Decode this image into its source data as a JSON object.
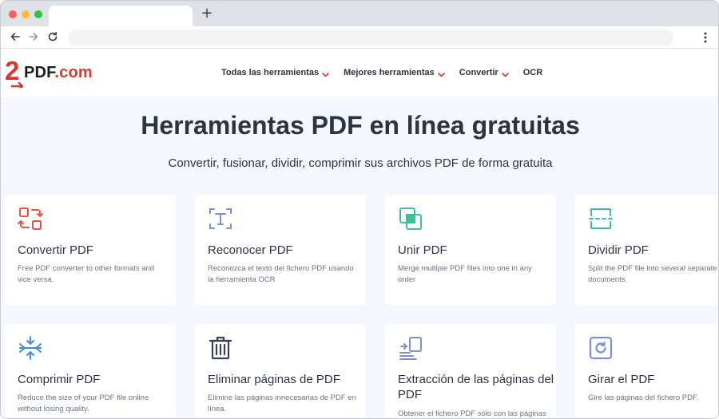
{
  "browser": {
    "new_tab_symbol": "+"
  },
  "site": {
    "logo_two": "2",
    "logo_name": "PDF",
    "logo_tld": ".com"
  },
  "nav": {
    "items": [
      {
        "label": "Todas las herramientas"
      },
      {
        "label": "Mejores herramientas"
      },
      {
        "label": "Convertir"
      },
      {
        "label": "OCR"
      }
    ]
  },
  "hero": {
    "title": "Herramientas PDF en línea gratuitas",
    "subtitle": "Convertir, fusionar, dividir, comprimir sus archivos PDF de forma gratuita"
  },
  "tools": [
    {
      "title": "Convertir PDF",
      "description": "Free PDF converter to other formats and vice versa.",
      "icon": "convert-icon",
      "color": "#e5533d"
    },
    {
      "title": "Reconocer PDF",
      "description": "Reconozca el texto del fichero PDF usando la herramienta OCR",
      "icon": "ocr-text-icon",
      "color": "#7c8fd6"
    },
    {
      "title": "Unir PDF",
      "description": "Merge multiple PDF files into one in any order",
      "icon": "merge-icon",
      "color": "#3dbf9c"
    },
    {
      "title": "Dividir PDF",
      "description": "Split the PDF file into several separate documents.",
      "icon": "split-icon",
      "color": "#3dbf9c"
    },
    {
      "title": "Comprimir PDF",
      "description": "Reduce the size of your PDF file online without losing quality.",
      "icon": "compress-icon",
      "color": "#3b8fd9"
    },
    {
      "title": "Eliminar páginas de PDF",
      "description": "Elimine las páginas innecesarias de PDF en línea.",
      "icon": "trash-icon",
      "color": "#3a4150"
    },
    {
      "title": "Extracción de las páginas del PDF",
      "description": "Obtener el fichero PDF sólo con las páginas",
      "icon": "extract-pages-icon",
      "color": "#7c8fd6"
    },
    {
      "title": "Girar el PDF",
      "description": "Gire las páginas del fichero PDF.",
      "icon": "rotate-icon",
      "color": "#7c8fd6"
    }
  ],
  "colors": {
    "accent": "#d8392b",
    "hero_bg": "#f4f7fb",
    "text": "#2d3440"
  }
}
